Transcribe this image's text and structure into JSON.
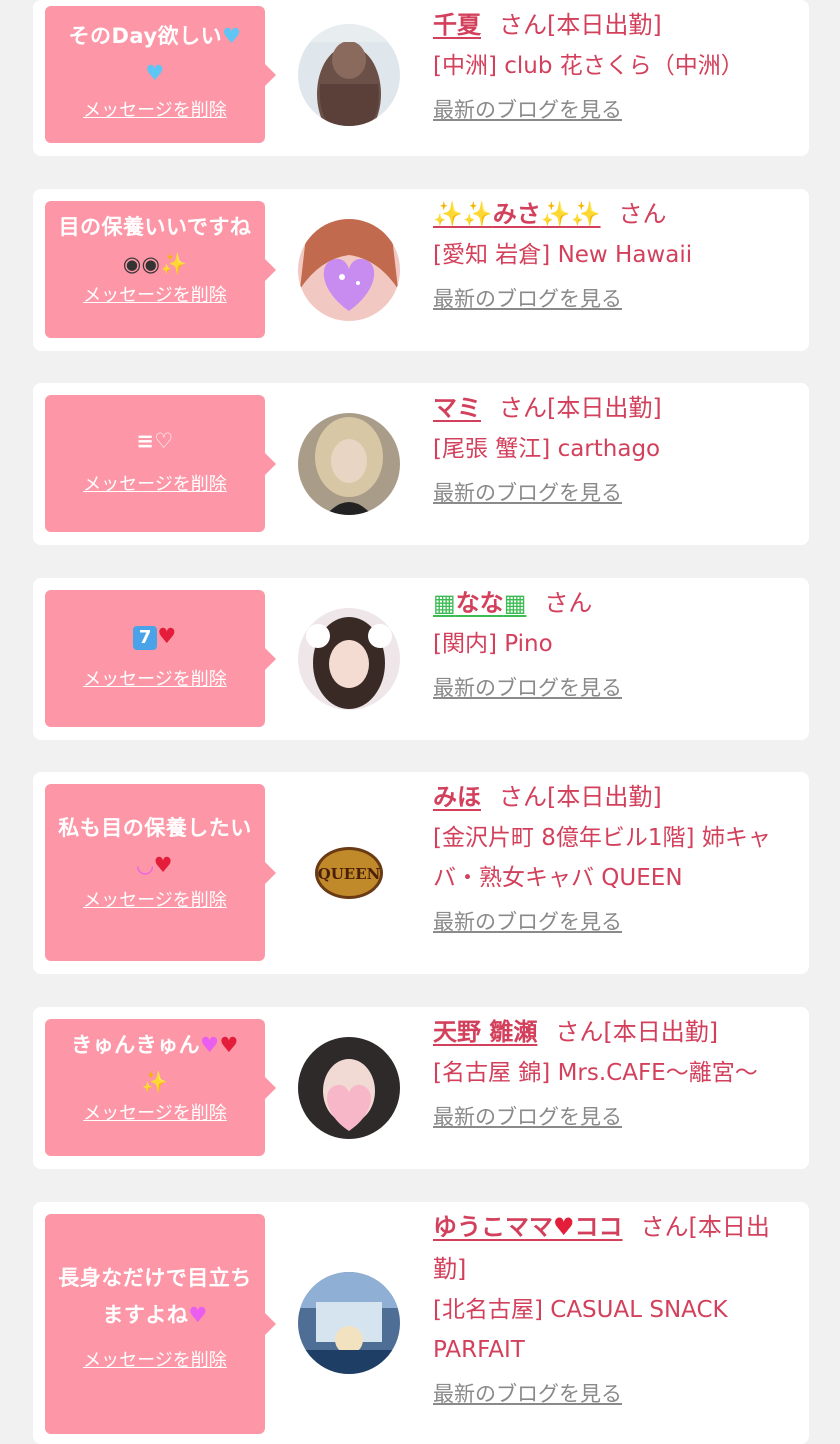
{
  "colors": {
    "accent": "#d3405c",
    "bubble": "#fd96a6",
    "link_gray": "#8a8a8a",
    "page_bg": "#f1f1f1"
  },
  "delete_label": "メッセージを削除",
  "blog_label": "最新のブログを見る",
  "san_label": "さん",
  "cards": [
    {
      "msg": "そのDay欲しい",
      "msg_emoji": "blue-heart-x2",
      "name": "千夏",
      "status": "[本日出勤]",
      "shop": "[中洲] club 花さくら（中洲）",
      "avatar": "woman-long-wavy-hair-photo"
    },
    {
      "msg": "目の保養いいですね",
      "msg_emoji": "eyes-sparkles",
      "name": "みさ",
      "name_emoji": "sparkles",
      "status": "",
      "shop": "[愛知 岩倉] New Hawaii",
      "avatar": "woman-face-covered-by-heart-photo"
    },
    {
      "msg": "≡♡",
      "name": "マミ",
      "status": "[本日出勤]",
      "shop": "[尾張 蟹江] carthago",
      "avatar": "woman-blurred-blonde-photo"
    },
    {
      "msg": "7",
      "msg_emoji": "keycap-seven-sparkling-heart",
      "name": "なな",
      "name_emoji": "office-building",
      "status": "",
      "shop": "[関内] Pino",
      "avatar": "woman-twintails-photo"
    },
    {
      "msg": "私も目の保養したい",
      "msg_emoji": "smile-two-hearts",
      "name": "みほ",
      "status": "[本日出勤]",
      "shop": "[金沢片町 8億年ビル1階] 姉キャバ・熟女キャバ QUEEN",
      "avatar": "queen-gold-logo",
      "logo_text": "QUEEN"
    },
    {
      "msg": "きゅんきゅん",
      "msg_emoji": "hearts-sparkle",
      "name": "天野 雛瀬",
      "status": "[本日出勤]",
      "shop": "[名古屋 錦] Mrs.CAFE～離宮～",
      "avatar": "woman-face-covered-by-pink-heart-photo"
    },
    {
      "msg": "長身なだけで目立ちますよね",
      "msg_emoji": "sparkling-heart",
      "name": "ゆうこママ",
      "name_suffix": "ココ",
      "status": "[本日出勤]",
      "shop": "[北名古屋] CASUAL SNACK PARFAIT",
      "avatar": "bar-interior-photo"
    }
  ]
}
